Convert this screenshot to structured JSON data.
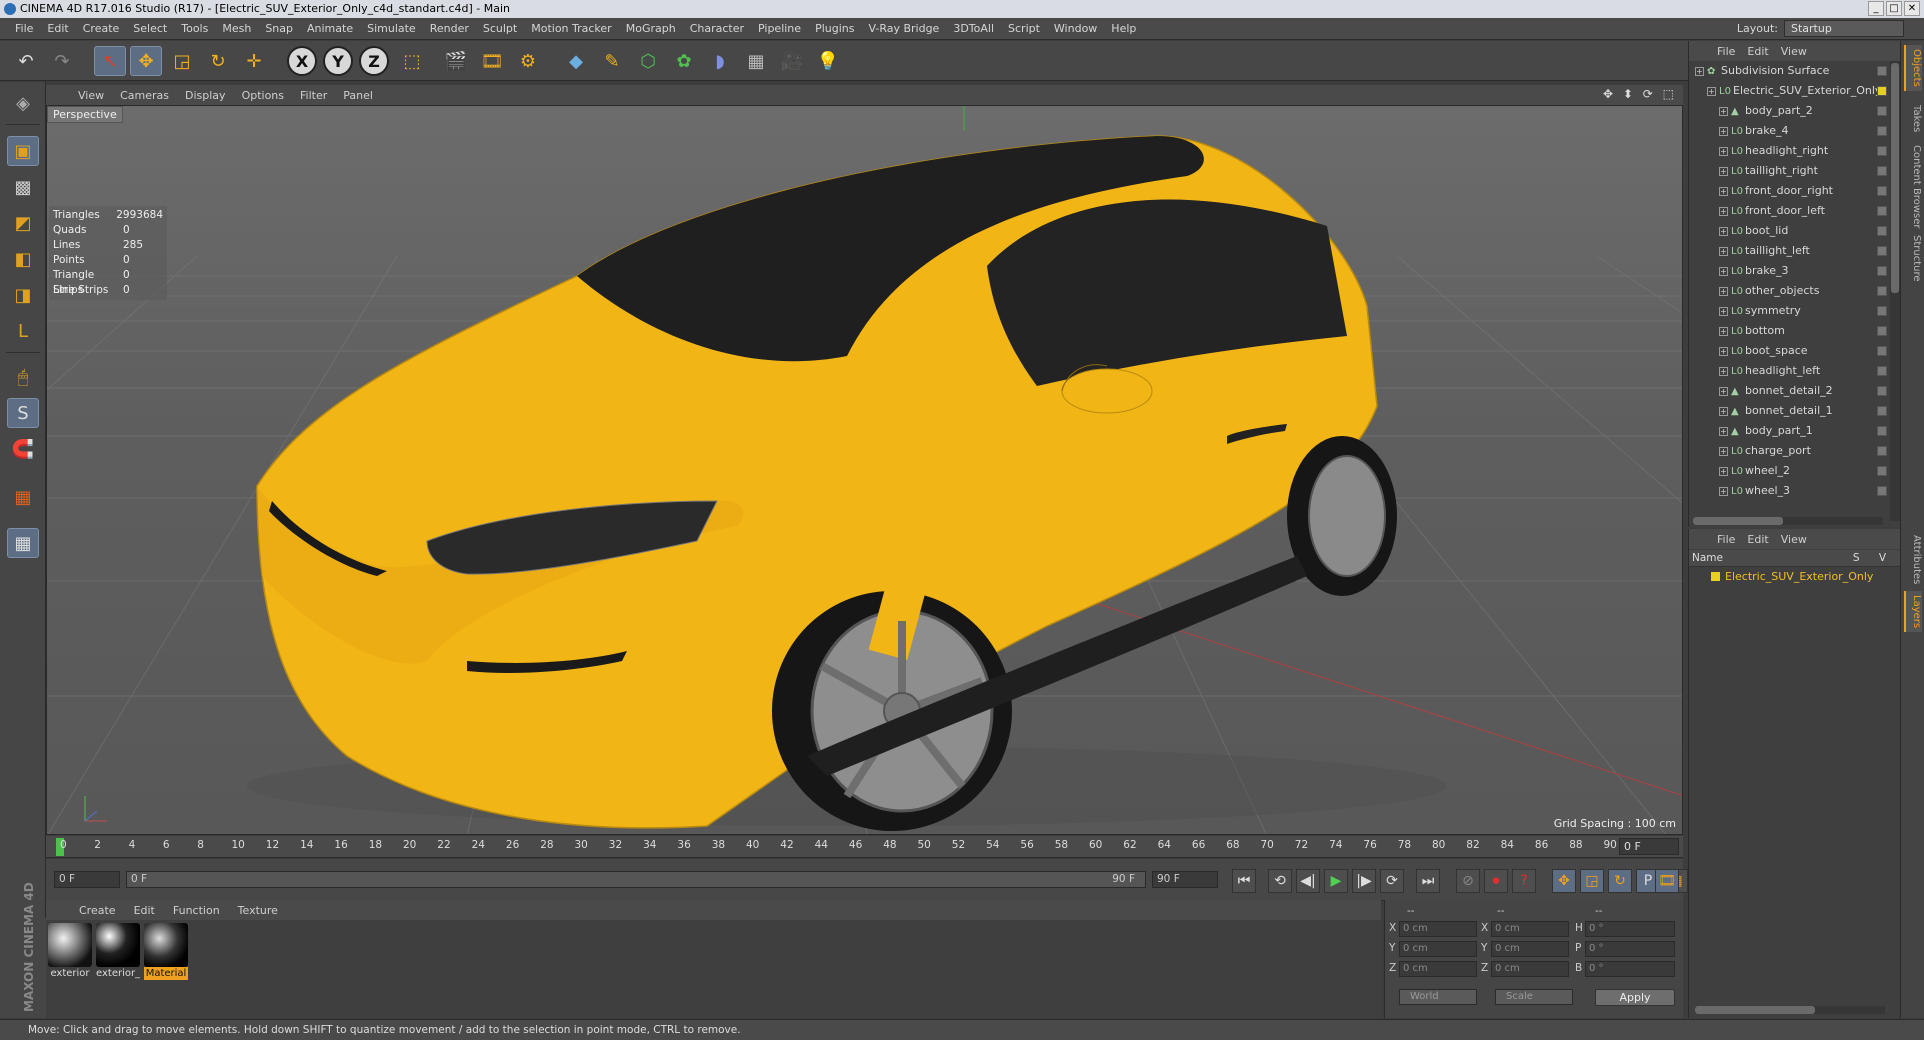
{
  "window": {
    "title": "CINEMA 4D R17.016 Studio (R17) - [Electric_SUV_Exterior_Only_c4d_standart.c4d] - Main",
    "min": "_",
    "max": "□",
    "close": "✕"
  },
  "menu": [
    "File",
    "Edit",
    "Create",
    "Select",
    "Tools",
    "Mesh",
    "Snap",
    "Animate",
    "Simulate",
    "Render",
    "Sculpt",
    "Motion Tracker",
    "MoGraph",
    "Character",
    "Pipeline",
    "Plugins",
    "V-Ray Bridge",
    "3DToAll",
    "Script",
    "Window",
    "Help"
  ],
  "layout": {
    "label": "Layout:",
    "value": "Startup"
  },
  "toolbar": {
    "undo": "↶",
    "redo": "↷",
    "live_select": "↖",
    "move": "✥",
    "scale": "◲",
    "rotate": "↻",
    "transform": "✛",
    "axis_x": "X",
    "axis_y": "Y",
    "axis_z": "Z",
    "coord": "⬚",
    "render_view": "🎬",
    "render_pic": "🎞",
    "render_settings": "⚙",
    "cube": "◆",
    "pen": "✎",
    "subdivide": "⬡",
    "mograph": "✿",
    "deformer": "◗",
    "floor": "▦",
    "camera": "🎥",
    "light": "💡"
  },
  "lefttools": [
    "◈",
    "▣",
    "▩",
    "◩",
    "◧",
    "◨",
    "L",
    "🖱",
    "S",
    "🧲",
    "▦",
    "▦"
  ],
  "viewport": {
    "menu": [
      "View",
      "Cameras",
      "Display",
      "Options",
      "Filter",
      "Panel"
    ],
    "nav_icons": "✥ ⬍ ⟳ ⬚",
    "label": "Perspective",
    "stats": [
      {
        "k": "Triangles",
        "v": "2993684"
      },
      {
        "k": "Quads",
        "v": "0"
      },
      {
        "k": "Lines",
        "v": "285"
      },
      {
        "k": "Points",
        "v": "0"
      },
      {
        "k": "Triangle Strips",
        "v": "0"
      },
      {
        "k": "Line Strips",
        "v": "0"
      }
    ],
    "grid_spacing": "Grid Spacing : 100 cm",
    "car_color": "#f2b516"
  },
  "timeline": {
    "ticks": [
      "0",
      "2",
      "4",
      "6",
      "8",
      "10",
      "12",
      "14",
      "16",
      "18",
      "20",
      "22",
      "24",
      "26",
      "28",
      "30",
      "32",
      "34",
      "36",
      "38",
      "40",
      "42",
      "44",
      "46",
      "48",
      "50",
      "52",
      "54",
      "56",
      "58",
      "60",
      "62",
      "64",
      "66",
      "68",
      "70",
      "72",
      "74",
      "76",
      "78",
      "80",
      "82",
      "84",
      "86",
      "88",
      "90"
    ],
    "current_frame": "0 F",
    "start": "0 F",
    "min": "0 F",
    "max_inner": "90 F",
    "end": "90 F",
    "transport": [
      "⏮",
      "⟲",
      "◀|",
      "▶",
      "|▶",
      "⟳",
      "⏭"
    ],
    "record": [
      "⊘",
      "⏺",
      "?"
    ],
    "keys": [
      "✥",
      "◲",
      "↻",
      "P",
      "▦"
    ],
    "film": "🎞"
  },
  "materials": {
    "menu": [
      "Create",
      "Edit",
      "Function",
      "Texture"
    ],
    "items": [
      {
        "name": "exterior"
      },
      {
        "name": "exterior_"
      },
      {
        "name": "Material"
      }
    ]
  },
  "branding": "MAXON CINEMA 4D",
  "coords": {
    "header": [
      "--",
      "--",
      "--"
    ],
    "rows": [
      {
        "a": "X",
        "av": "0 cm",
        "b": "X",
        "bv": "0 cm",
        "c": "H",
        "cv": "0 °"
      },
      {
        "a": "Y",
        "av": "0 cm",
        "b": "Y",
        "bv": "0 cm",
        "c": "P",
        "cv": "0 °"
      },
      {
        "a": "Z",
        "av": "0 cm",
        "b": "Z",
        "bv": "0 cm",
        "c": "B",
        "cv": "0 °"
      }
    ],
    "world": "World",
    "scale": "Scale",
    "apply": "Apply"
  },
  "object_manager": {
    "menu": [
      "File",
      "Edit",
      "View"
    ],
    "objects": [
      {
        "name": "Subdivision Surface",
        "level": 0,
        "icon": "✿",
        "tag": "plain"
      },
      {
        "name": "Electric_SUV_Exterior_Only",
        "level": 1,
        "icon": "L0",
        "tag": "yellow"
      },
      {
        "name": "body_part_2",
        "level": 2,
        "icon": "▲",
        "tag": "plain"
      },
      {
        "name": "brake_4",
        "level": 2,
        "icon": "L0",
        "tag": "plain"
      },
      {
        "name": "headlight_right",
        "level": 2,
        "icon": "L0",
        "tag": "plain"
      },
      {
        "name": "taillight_right",
        "level": 2,
        "icon": "L0",
        "tag": "plain"
      },
      {
        "name": "front_door_right",
        "level": 2,
        "icon": "L0",
        "tag": "plain"
      },
      {
        "name": "front_door_left",
        "level": 2,
        "icon": "L0",
        "tag": "plain"
      },
      {
        "name": "boot_lid",
        "level": 2,
        "icon": "L0",
        "tag": "plain"
      },
      {
        "name": "taillight_left",
        "level": 2,
        "icon": "L0",
        "tag": "plain"
      },
      {
        "name": "brake_3",
        "level": 2,
        "icon": "L0",
        "tag": "plain"
      },
      {
        "name": "other_objects",
        "level": 2,
        "icon": "L0",
        "tag": "plain"
      },
      {
        "name": "symmetry",
        "level": 2,
        "icon": "L0",
        "tag": "plain"
      },
      {
        "name": "bottom",
        "level": 2,
        "icon": "L0",
        "tag": "plain"
      },
      {
        "name": "boot_space",
        "level": 2,
        "icon": "L0",
        "tag": "plain"
      },
      {
        "name": "headlight_left",
        "level": 2,
        "icon": "L0",
        "tag": "plain"
      },
      {
        "name": "bonnet_detail_2",
        "level": 2,
        "icon": "▲",
        "tag": "plain"
      },
      {
        "name": "bonnet_detail_1",
        "level": 2,
        "icon": "▲",
        "tag": "plain"
      },
      {
        "name": "body_part_1",
        "level": 2,
        "icon": "▲",
        "tag": "plain"
      },
      {
        "name": "charge_port",
        "level": 2,
        "icon": "L0",
        "tag": "plain"
      },
      {
        "name": "wheel_2",
        "level": 2,
        "icon": "L0",
        "tag": "plain"
      },
      {
        "name": "wheel_3",
        "level": 2,
        "icon": "L0",
        "tag": "plain"
      }
    ]
  },
  "layer_manager": {
    "menu": [
      "File",
      "Edit",
      "View"
    ],
    "col_name": "Name",
    "col_sv": "S V",
    "layer": "Electric_SUV_Exterior_Only"
  },
  "right_tabs": [
    "Objects",
    "Takes",
    "Content Browser",
    "Structure",
    "Attributes",
    "Layers"
  ],
  "status": "Move: Click and drag to move elements. Hold down SHIFT to quantize movement / add to the selection in point mode, CTRL to remove."
}
